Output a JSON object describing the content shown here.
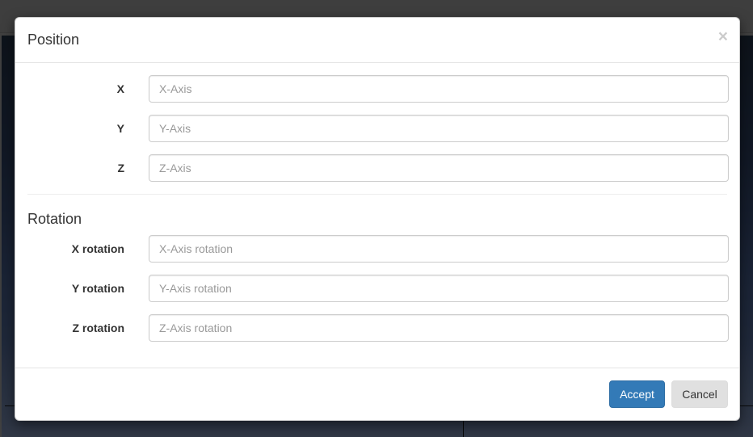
{
  "modal": {
    "title": "Position",
    "close_symbol": "×"
  },
  "position_fields": [
    {
      "label": "X",
      "placeholder": "X-Axis",
      "value": ""
    },
    {
      "label": "Y",
      "placeholder": "Y-Axis",
      "value": ""
    },
    {
      "label": "Z",
      "placeholder": "Z-Axis",
      "value": ""
    }
  ],
  "rotation": {
    "title": "Rotation",
    "fields": [
      {
        "label": "X rotation",
        "placeholder": "X-Axis rotation",
        "value": ""
      },
      {
        "label": "Y rotation",
        "placeholder": "Y-Axis rotation",
        "value": ""
      },
      {
        "label": "Z rotation",
        "placeholder": "Z-Axis rotation",
        "value": ""
      }
    ]
  },
  "footer": {
    "accept_label": "Accept",
    "cancel_label": "Cancel"
  },
  "colors": {
    "primary": "#337ab7",
    "backdrop": "#000000",
    "default_button": "#e0e0e0"
  },
  "icons": {
    "close": "close-icon"
  }
}
